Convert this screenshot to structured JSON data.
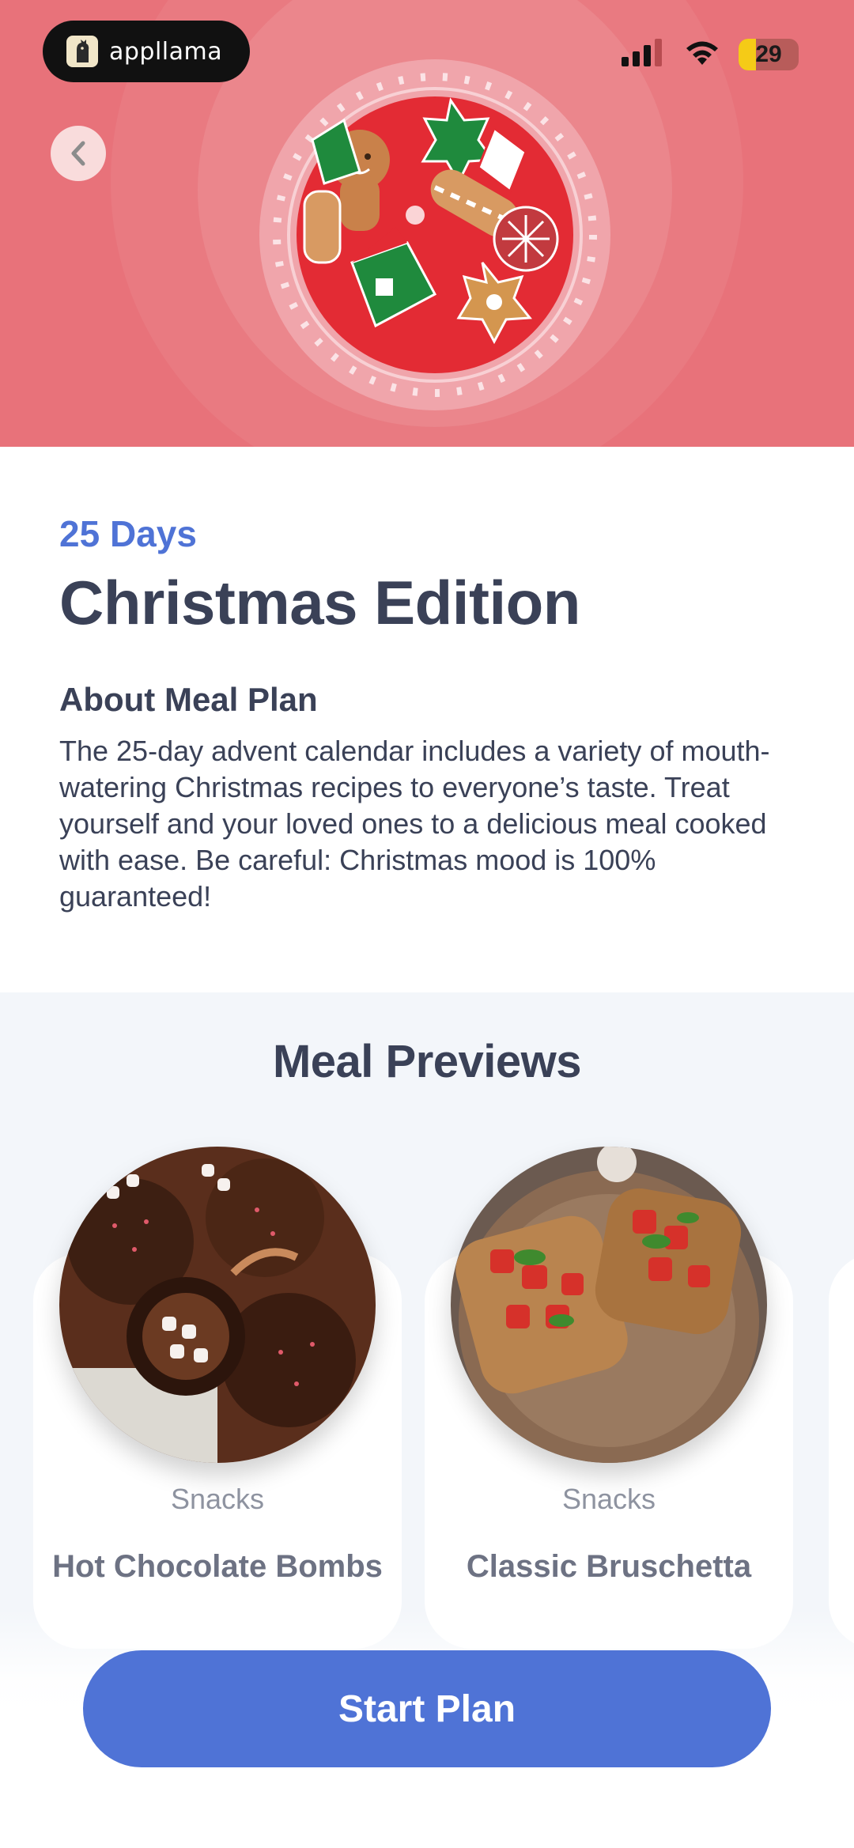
{
  "status_bar": {
    "app_name": "appllama",
    "battery_level": "29",
    "icons": [
      "signal-icon",
      "wifi-icon",
      "battery-icon"
    ]
  },
  "hero": {
    "background_color": "#e8727a",
    "image": "christmas-cookies-plate"
  },
  "plan": {
    "duration": "25 Days",
    "title": "Christmas Edition",
    "about_heading": "About Meal Plan",
    "about_text": "The 25-day advent calendar includes a variety of mouth-watering Christmas recipes to everyone’s taste. Treat yourself and your loved ones to a delicious meal cooked with ease. Be careful: Christmas mood is 100% guaranteed!"
  },
  "previews": {
    "heading": "Meal Previews",
    "meals": [
      {
        "category": "Snacks",
        "name": "Hot Chocolate Bombs",
        "image": "hot-chocolate-bombs"
      },
      {
        "category": "Snacks",
        "name": "Classic Bruschetta",
        "image": "classic-bruschetta"
      }
    ]
  },
  "actions": {
    "start_label": "Start Plan",
    "accent_color": "#4f73d6"
  }
}
